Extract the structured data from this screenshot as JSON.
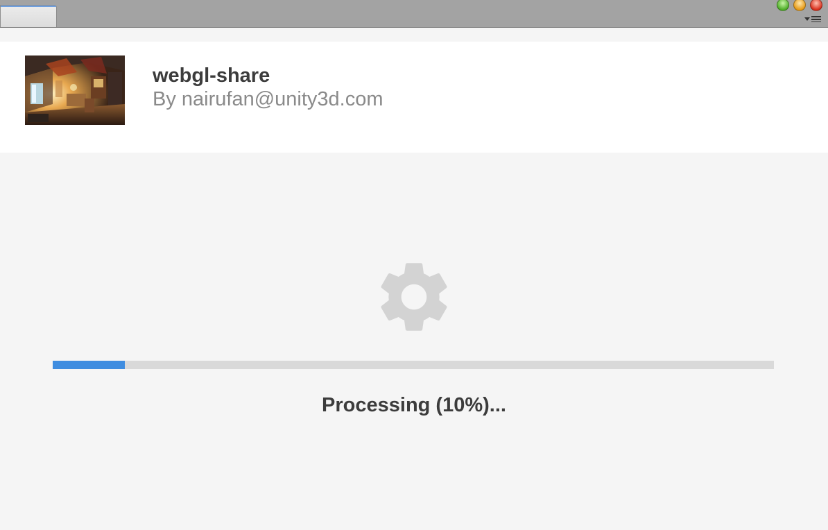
{
  "window": {
    "tab_label": "",
    "window_controls": [
      "minimize",
      "zoom",
      "close"
    ],
    "menu_icon": "hamburger-menu-icon"
  },
  "project": {
    "title": "webgl-share",
    "author": "By nairufan@unity3d.com",
    "thumbnail_icon": "project-thumbnail"
  },
  "processing": {
    "icon": "gear-icon",
    "progress": 0.1,
    "status_text": "Processing (10%)..."
  },
  "colors": {
    "progress_fill": "#3f8de0",
    "progress_track": "#d9d9d9",
    "gear": "#d3d3d3",
    "title": "#3c3c3c",
    "author": "#8a8a8a"
  }
}
